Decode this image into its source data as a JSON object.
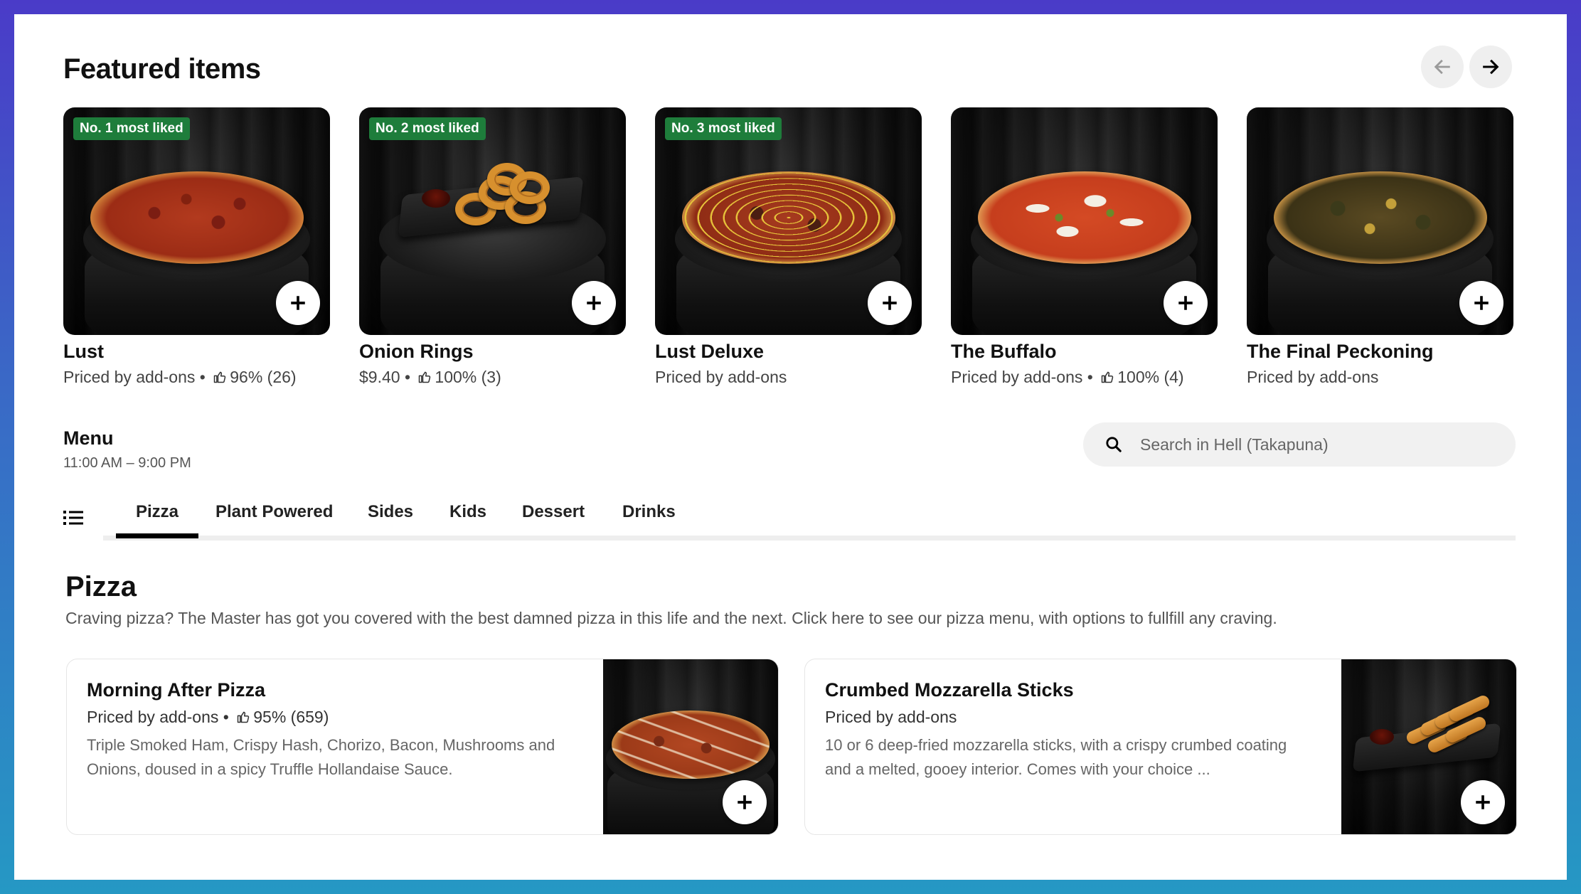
{
  "featured": {
    "title": "Featured items",
    "items": [
      {
        "badge": "No. 1 most liked",
        "name": "Lust",
        "price": "Priced by add-ons",
        "rating": "96% (26)"
      },
      {
        "badge": "No. 2 most liked",
        "name": "Onion Rings",
        "price": "$9.40",
        "rating": "100% (3)"
      },
      {
        "badge": "No. 3 most liked",
        "name": "Lust Deluxe",
        "price": "Priced by add-ons",
        "rating": ""
      },
      {
        "badge": "",
        "name": "The Buffalo",
        "price": "Priced by add-ons",
        "rating": "100% (4)"
      },
      {
        "badge": "",
        "name": "The Final Peckoning",
        "price": "Priced by add-ons",
        "rating": ""
      }
    ]
  },
  "nav": {
    "prev_icon": "arrow-left-icon",
    "next_icon": "arrow-right-icon"
  },
  "menu": {
    "title": "Menu",
    "hours": "11:00 AM – 9:00 PM",
    "search_placeholder": "Search in Hell (Takapuna)",
    "tabs": [
      "Pizza",
      "Plant Powered",
      "Sides",
      "Kids",
      "Dessert",
      "Drinks"
    ],
    "active_tab": "Pizza"
  },
  "section": {
    "title": "Pizza",
    "description": "Craving pizza? The Master has got you covered with the best damned pizza in this life and the next. Click here to see our pizza menu, with options to fullfill any craving.",
    "items": [
      {
        "name": "Morning After Pizza",
        "price": "Priced by add-ons",
        "rating": "95% (659)",
        "description": "Triple Smoked Ham, Crispy Hash, Chorizo, Bacon, Mushrooms and Onions, doused in a spicy Truffle Hollandaise Sauce."
      },
      {
        "name": "Crumbed Mozzarella Sticks",
        "price": "Priced by add-ons",
        "rating": "",
        "description": "10 or 6 deep-fried mozzarella sticks, with a crispy crumbed coating and a melted, gooey interior. Comes with your choice ..."
      }
    ]
  },
  "colors": {
    "badge_green": "#1e7d3b",
    "active_tab_underline": "#000000",
    "frame_gradient_top": "#4a3bc8",
    "frame_gradient_bottom": "#2598c4"
  },
  "separator": " • "
}
